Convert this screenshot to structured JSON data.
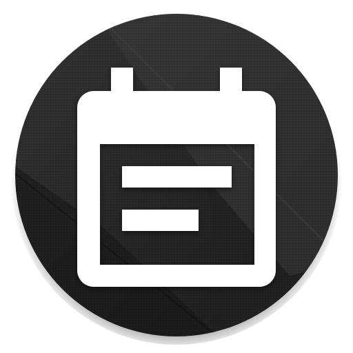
{
  "icon": {
    "name": "calendar-event-icon",
    "colors": {
      "background_dark": "#1c1c1c",
      "background_mid": "#2a2a2a",
      "background_light": "#3a3a3a",
      "glyph": "#ffffff"
    }
  }
}
